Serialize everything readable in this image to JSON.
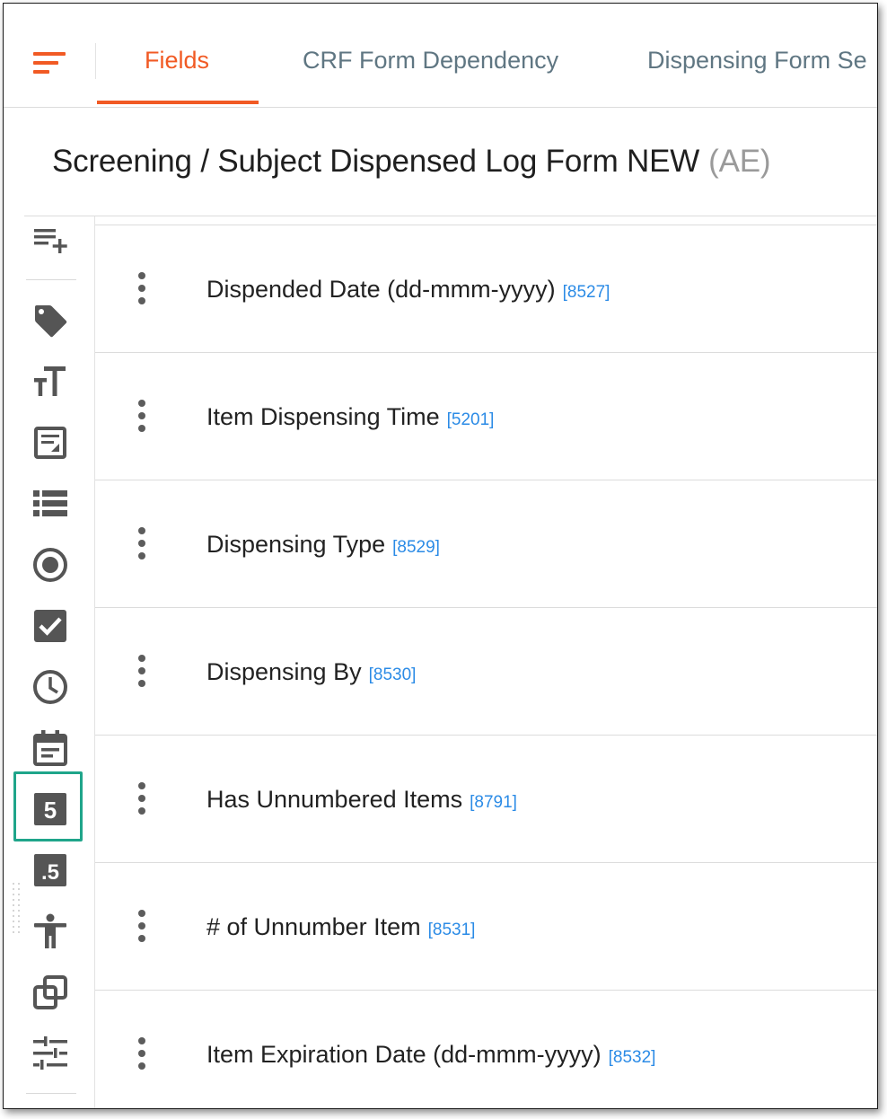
{
  "tabs": [
    {
      "label": "Fields",
      "active": true
    },
    {
      "label": "CRF Form Dependency",
      "active": false
    },
    {
      "label": "Dispensing Form Se",
      "active": false
    }
  ],
  "form": {
    "title": "Screening / Subject Dispensed Log Form NEW",
    "suffix": "(AE)"
  },
  "toolbar": {
    "tools": [
      {
        "name": "add-field-icon"
      },
      {
        "name": "tag-icon"
      },
      {
        "name": "text-size-icon"
      },
      {
        "name": "text-area-icon"
      },
      {
        "name": "list-icon"
      },
      {
        "name": "radio-button-icon"
      },
      {
        "name": "checkbox-icon"
      },
      {
        "name": "clock-icon"
      },
      {
        "name": "calendar-icon"
      },
      {
        "name": "integer-number-icon",
        "glyph": "5",
        "selected": true
      },
      {
        "name": "decimal-number-icon",
        "glyph": ".5"
      },
      {
        "name": "body-icon"
      },
      {
        "name": "copy-icon"
      },
      {
        "name": "sliders-icon"
      }
    ]
  },
  "fields": [
    {
      "label": "Dispended Date (dd-mmm-yyyy)",
      "id": "[8527]"
    },
    {
      "label": "Item Dispensing Time",
      "id": "[5201]"
    },
    {
      "label": "Dispensing Type",
      "id": "[8529]"
    },
    {
      "label": "Dispensing By",
      "id": "[8530]"
    },
    {
      "label": "Has Unnumbered Items",
      "id": "[8791]"
    },
    {
      "label": "# of Unnumber Item",
      "id": "[8531]"
    },
    {
      "label": "Item Expiration Date (dd-mmm-yyyy)",
      "id": "[8532]"
    }
  ],
  "colors": {
    "accent": "#f15a24",
    "tab_inactive": "#5f7682",
    "field_id": "#2b8be6",
    "highlight": "#1fa58a",
    "icon": "#555555"
  }
}
